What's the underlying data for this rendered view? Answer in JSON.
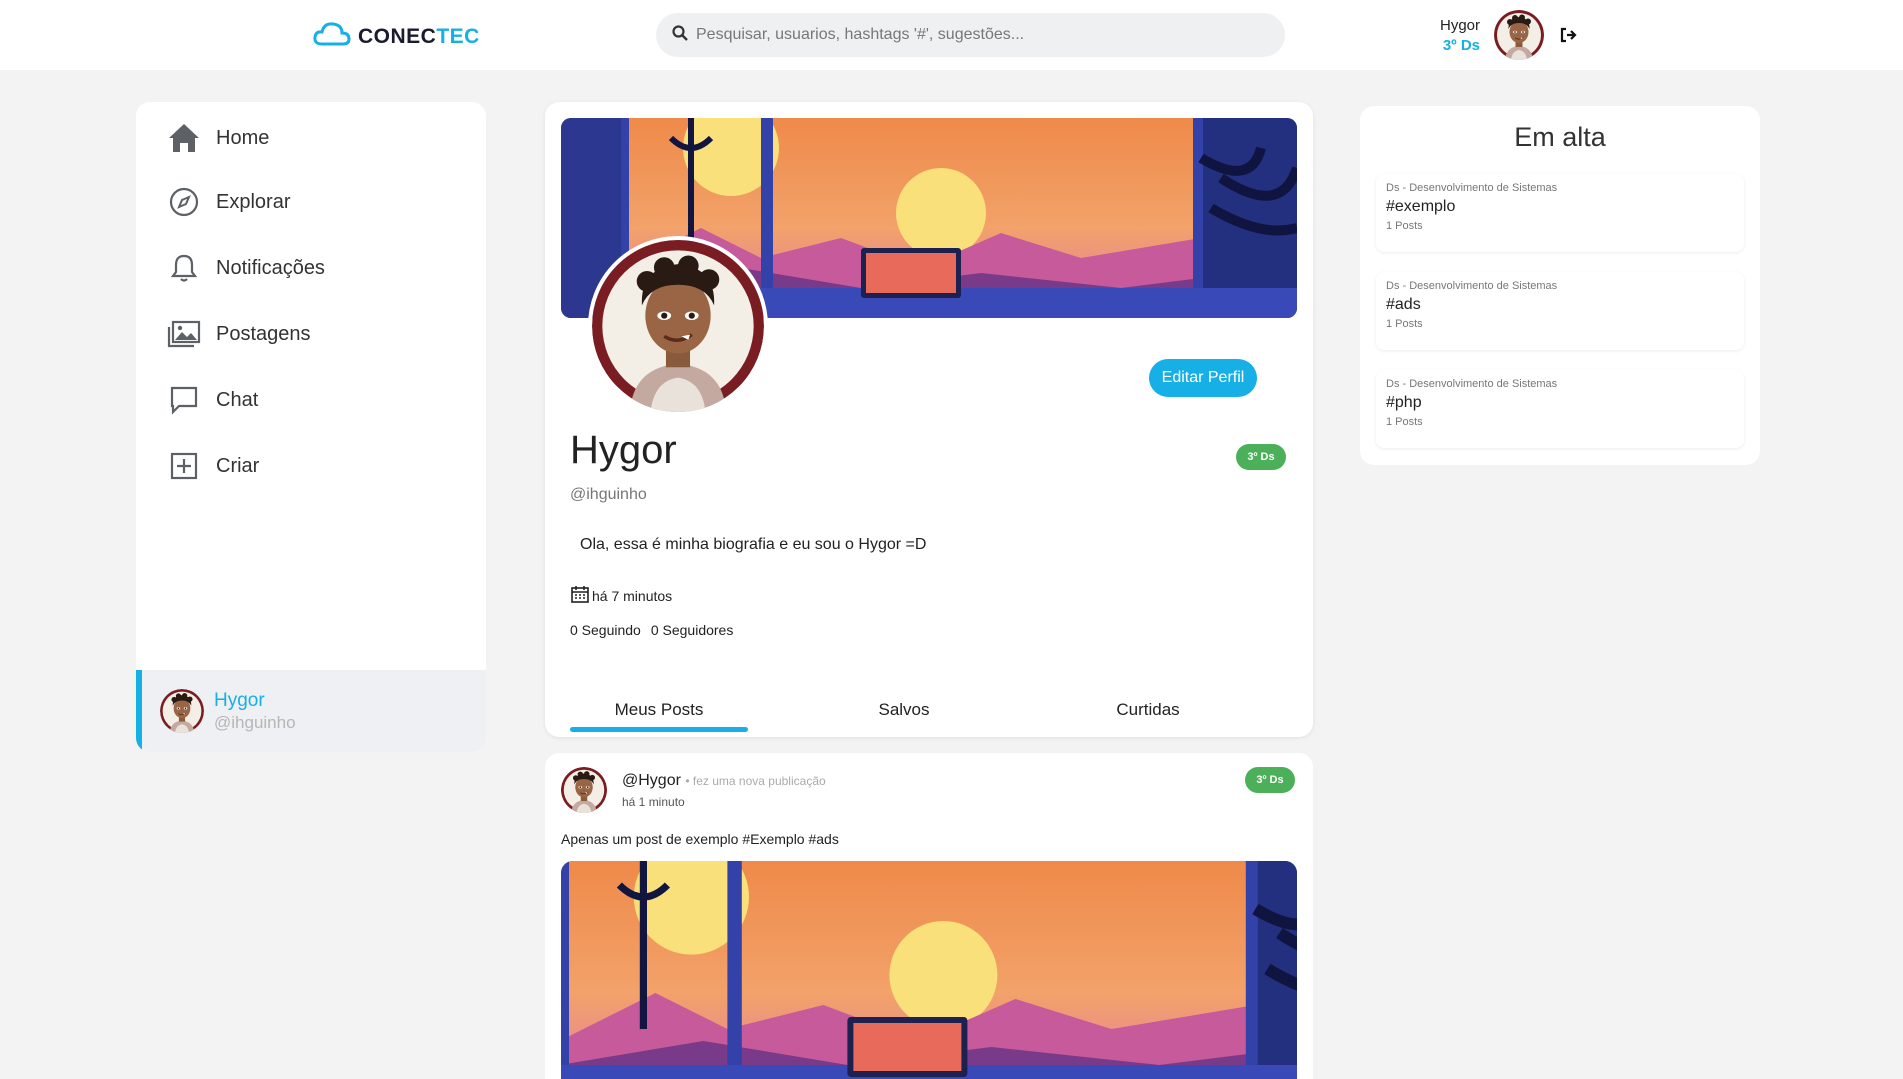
{
  "header": {
    "logo_main": "CONEC",
    "logo_accent": "TEC",
    "search_placeholder": "Pesquisar, usuarios, hashtags '#', sugestões...",
    "user_name": "Hygor",
    "user_class": "3º Ds"
  },
  "nav": {
    "items": [
      {
        "label": "Home",
        "icon": "home-icon"
      },
      {
        "label": "Explorar",
        "icon": "compass-icon"
      },
      {
        "label": "Notificações",
        "icon": "bell-icon"
      },
      {
        "label": "Postagens",
        "icon": "images-icon"
      },
      {
        "label": "Chat",
        "icon": "chat-icon"
      },
      {
        "label": "Criar",
        "icon": "plus-square-icon"
      }
    ],
    "user_name": "Hygor",
    "user_handle": "@ihguinho"
  },
  "profile": {
    "name": "Hygor",
    "handle": "@ihguinho",
    "badge": "3º Ds",
    "edit_label": "Editar Perfil",
    "bio": "Ola, essa é minha biografia e eu sou o Hygor =D",
    "joined": "há 7 minutos",
    "following": "0 Seguindo",
    "followers": "0 Seguidores",
    "tabs": [
      "Meus Posts",
      "Salvos",
      "Curtidas"
    ]
  },
  "post": {
    "user": "@Hygor",
    "action": "• fez uma nova publicação",
    "time": "há 1 minuto",
    "badge": "3º Ds",
    "text": "Apenas um post de exemplo #Exemplo #ads"
  },
  "trending": {
    "title": "Em alta",
    "items": [
      {
        "category": "Ds - Desenvolvimento de Sistemas",
        "tag": "#exemplo",
        "count": "1 Posts"
      },
      {
        "category": "Ds - Desenvolvimento de Sistemas",
        "tag": "#ads",
        "count": "1 Posts"
      },
      {
        "category": "Ds - Desenvolvimento de Sistemas",
        "tag": "#php",
        "count": "1 Posts"
      }
    ]
  },
  "colors": {
    "accent": "#17b0e6",
    "badge_green": "#4caf5a",
    "background": "#f3f3f4"
  }
}
